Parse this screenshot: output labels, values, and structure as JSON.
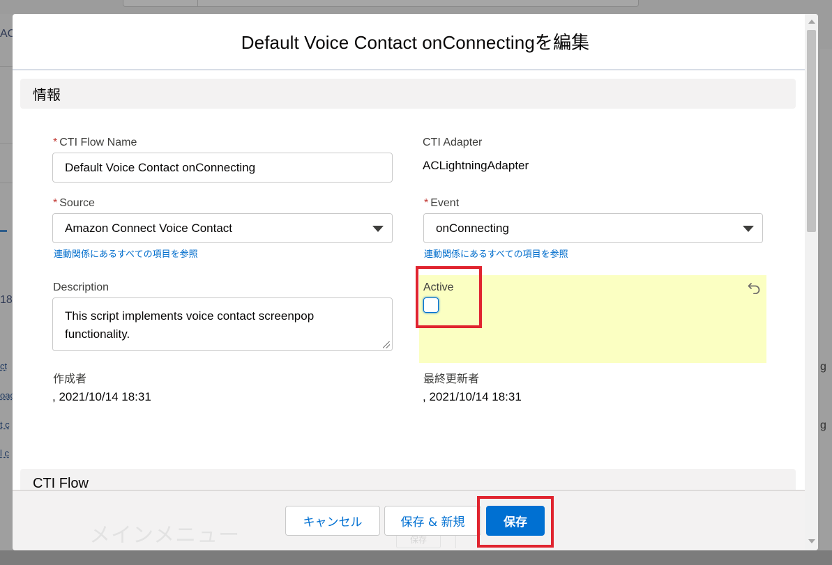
{
  "modal": {
    "title": "Default Voice Contact onConnectingを編集"
  },
  "background": {
    "left_fragments": [
      "AC",
      "18",
      "ct",
      "oac",
      "t c",
      "l c"
    ],
    "right_fragments": [
      "g",
      "g"
    ]
  },
  "sections": {
    "info": "情報",
    "cti_flow": "CTI Flow"
  },
  "fields": {
    "cti_flow_name": {
      "required_mark": "*",
      "label": "CTI Flow Name",
      "value": "Default Voice Contact onConnecting"
    },
    "cti_adapter": {
      "label": "CTI Adapter",
      "value": "ACLightningAdapter"
    },
    "source": {
      "required_mark": "*",
      "label": "Source",
      "value": "Amazon Connect Voice Contact",
      "link": "連動関係にあるすべての項目を参照"
    },
    "event": {
      "required_mark": "*",
      "label": "Event",
      "value": "onConnecting",
      "link": "連動関係にあるすべての項目を参照"
    },
    "description": {
      "label": "Description",
      "value": "This script implements voice contact screenpop functionality."
    },
    "active": {
      "label": "Active",
      "checked": false
    },
    "created_by": {
      "label": "作成者",
      "value": ", 2021/10/14 18:31"
    },
    "last_modified_by": {
      "label": "最終更新者",
      "value": ", 2021/10/14 18:31"
    }
  },
  "footer": {
    "ghost_text": "メインメニュー",
    "ghost_button": "保存",
    "cancel_label": "キャンセル",
    "save_new_label": "保存 & 新規",
    "save_label": "保存"
  },
  "colors": {
    "brand": "#0070d2",
    "highlight": "#fbffc2",
    "annotation_red": "#e0242f",
    "required": "#c23934"
  },
  "icons": {
    "undo": "undo-icon",
    "select_caret": "chevron-down-icon"
  }
}
